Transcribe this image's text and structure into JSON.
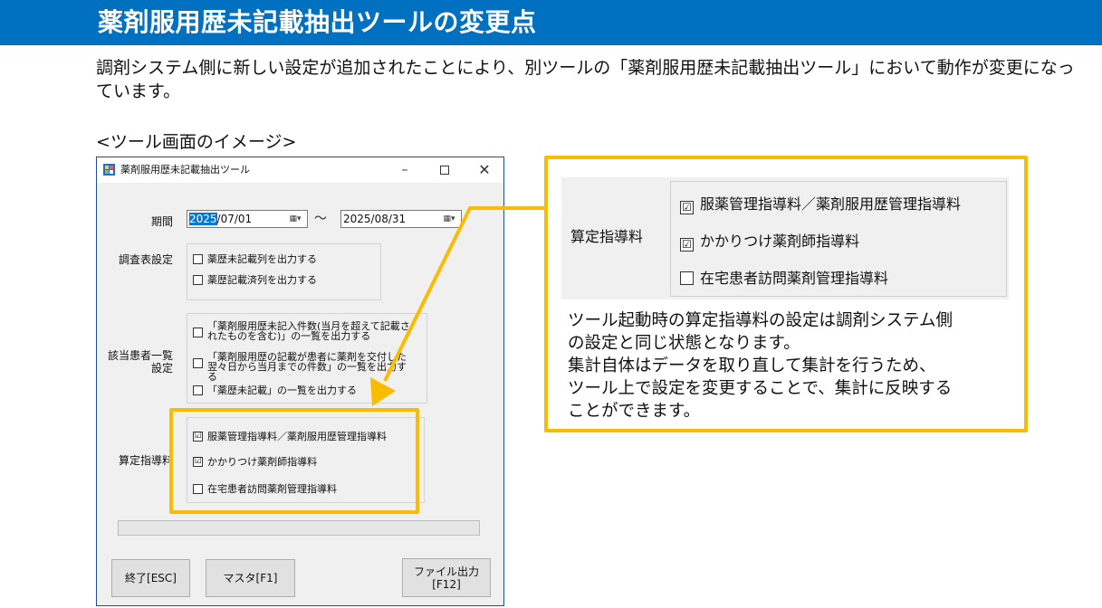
{
  "slide": {
    "title": "薬剤服用歴未記載抽出ツールの変更点",
    "description": "調剤システム側に新しい設定が追加されたことにより、別ツールの「薬剤服用歴未記載抽出ツール」において動作が変更になっています。",
    "image_caption": "<ツール画面のイメージ>"
  },
  "window": {
    "title": "薬剤服用歴未記載抽出ツール",
    "controls": {
      "minimize": "–",
      "close": "✕"
    },
    "period": {
      "label": "期間",
      "start_year": "2025",
      "start_rest": "/07/01",
      "separator": "～",
      "end_date": "2025/08/31",
      "dropdown_glyph": "▦▾"
    },
    "survey": {
      "label": "調査表設定",
      "options": [
        {
          "label": "薬歴未記載列を出力する",
          "checked": false
        },
        {
          "label": "薬歴記載済列を出力する",
          "checked": false
        }
      ]
    },
    "patient": {
      "label": "該当患者一覧設定",
      "options": [
        {
          "label": "「薬剤服用歴未記入件数(当月を超えて記載されたものを含む)」の一覧を出力する",
          "checked": false
        },
        {
          "label": "「薬剤服用歴の記載が患者に薬剤を交付した翌々日から当月までの件数」の一覧を出力する",
          "checked": false
        },
        {
          "label": "「薬歴未記載」の一覧を出力する",
          "checked": false
        }
      ]
    },
    "fee": {
      "label": "算定指導料",
      "options": [
        {
          "label": "服薬管理指導料／薬剤服用歴管理指導料",
          "checked": true
        },
        {
          "label": "かかりつけ薬剤師指導料",
          "checked": true
        },
        {
          "label": "在宅患者訪問薬剤管理指導料",
          "checked": false
        }
      ]
    },
    "buttons": {
      "exit": "終了[ESC]",
      "master": "マスタ[F1]",
      "file_line1": "ファイル出力",
      "file_line2": "[F12]"
    }
  },
  "zoom": {
    "label": "算定指導料",
    "options": [
      {
        "label": "服薬管理指導料／薬剤服用歴管理指導料",
        "checked": true
      },
      {
        "label": "かかりつけ薬剤師指導料",
        "checked": true
      },
      {
        "label": "在宅患者訪問薬剤管理指導料",
        "checked": false
      }
    ]
  },
  "note": {
    "line1": "ツール起動時の算定指導料の設定は調剤システム側",
    "line2": "の設定と同じ状態となります。",
    "line3": "集計自体はデータを取り直して集計を行うため、",
    "line4": "ツール上で設定を変更することで、集計に反映する",
    "line5": "ことができます。"
  },
  "colors": {
    "header_blue": "#0070c0",
    "highlight_yellow": "#f9bc00",
    "window_border": "#1e4f95",
    "window_bg": "#f0f0f0",
    "selection_blue": "#0078d7"
  },
  "icons": {
    "app": "app-window-icon",
    "check": "☑",
    "uncheck": "☐",
    "calendar_dropdown": "calendar-dropdown-icon"
  }
}
